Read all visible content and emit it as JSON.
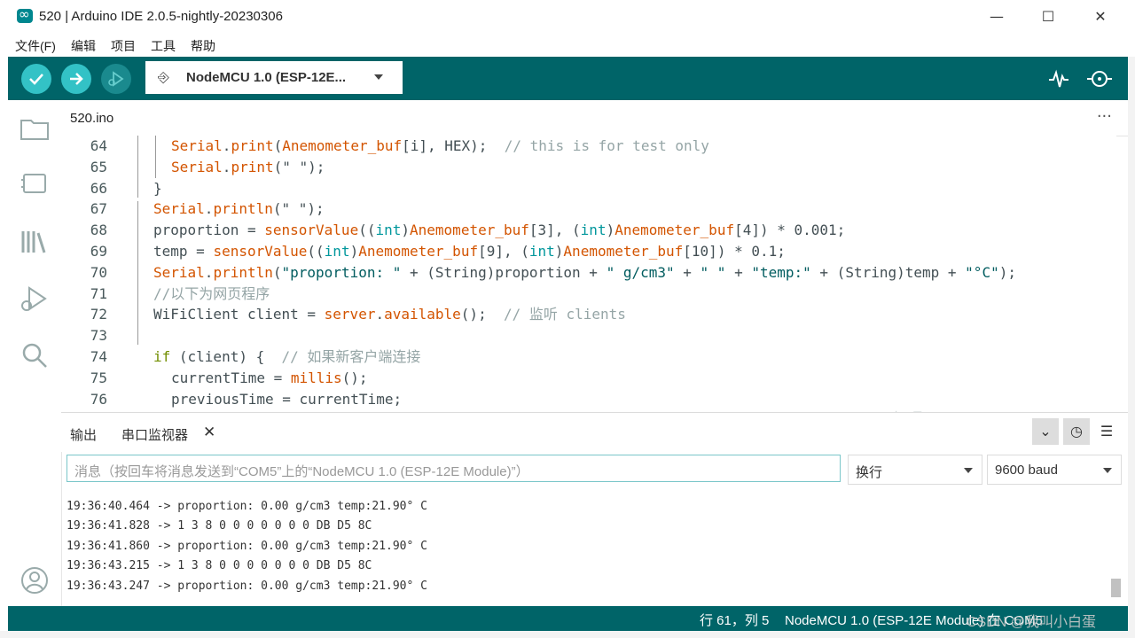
{
  "window": {
    "title": "520 | Arduino IDE 2.0.5-nightly-20230306",
    "minimize": "—",
    "maximize": "☐",
    "close": "✕"
  },
  "menu": [
    "文件(F)",
    "编辑",
    "项目",
    "工具",
    "帮助"
  ],
  "toolbar": {
    "verify_icon": "check-icon",
    "upload_icon": "arrow-right-icon",
    "debug_icon": "debug-icon",
    "board_name": "NodeMCU 1.0 (ESP-12E...",
    "usb_icon": "⎆",
    "plotter_icon": "⌇",
    "monitor_icon": "⊙"
  },
  "sidebar": [
    "folder-icon",
    "board-icon",
    "library-icon",
    "debug-icon",
    "search-icon",
    "account-icon"
  ],
  "tab": {
    "filename": "520.ino",
    "more": "···"
  },
  "code": [
    {
      "ln": "64",
      "indent": 6,
      "parts": [
        [
          "fn",
          "Serial"
        ],
        [
          "",
          "."
        ],
        [
          "fn",
          "print"
        ],
        [
          "",
          "("
        ],
        [
          "fn",
          "Anemometer_buf"
        ],
        [
          "",
          "[i], HEX);  "
        ],
        [
          "cmt",
          "// this is for test only"
        ]
      ]
    },
    {
      "ln": "65",
      "indent": 6,
      "parts": [
        [
          "fn",
          "Serial"
        ],
        [
          "",
          "."
        ],
        [
          "fn",
          "print"
        ],
        [
          "",
          "(\" \");"
        ]
      ]
    },
    {
      "ln": "66",
      "indent": 4,
      "parts": [
        [
          "",
          "}"
        ]
      ]
    },
    {
      "ln": "67",
      "indent": 4,
      "parts": [
        [
          "fn",
          "Serial"
        ],
        [
          "",
          "."
        ],
        [
          "fn",
          "println"
        ],
        [
          "",
          "(\" \");"
        ]
      ]
    },
    {
      "ln": "68",
      "indent": 4,
      "parts": [
        [
          "",
          "proportion = "
        ],
        [
          "fn",
          "sensorValue"
        ],
        [
          "",
          "(("
        ],
        [
          "type",
          "int"
        ],
        [
          "",
          ")"
        ],
        [
          "fn",
          "Anemometer_buf"
        ],
        [
          "",
          "[3], ("
        ],
        [
          "type",
          "int"
        ],
        [
          "",
          ")"
        ],
        [
          "fn",
          "Anemometer_buf"
        ],
        [
          "",
          "[4]) * 0.001;"
        ]
      ]
    },
    {
      "ln": "69",
      "indent": 4,
      "parts": [
        [
          "",
          "temp = "
        ],
        [
          "fn",
          "sensorValue"
        ],
        [
          "",
          "(("
        ],
        [
          "type",
          "int"
        ],
        [
          "",
          ")"
        ],
        [
          "fn",
          "Anemometer_buf"
        ],
        [
          "",
          "[9], ("
        ],
        [
          "type",
          "int"
        ],
        [
          "",
          ")"
        ],
        [
          "fn",
          "Anemometer_buf"
        ],
        [
          "",
          "[10]) * 0.1;"
        ]
      ]
    },
    {
      "ln": "70",
      "indent": 4,
      "parts": [
        [
          "fn",
          "Serial"
        ],
        [
          "",
          "."
        ],
        [
          "fn",
          "println"
        ],
        [
          "",
          "("
        ],
        [
          "str",
          "\"proportion: \""
        ],
        [
          "",
          " + (String)proportion + "
        ],
        [
          "str",
          "\" g/cm3\""
        ],
        [
          "",
          " + "
        ],
        [
          "str",
          "\" \""
        ],
        [
          "",
          " + "
        ],
        [
          "str",
          "\"temp:\""
        ],
        [
          "",
          " + (String)temp + "
        ],
        [
          "str",
          "\"°C\""
        ],
        [
          "",
          ");"
        ]
      ]
    },
    {
      "ln": "71",
      "indent": 4,
      "parts": [
        [
          "cmt",
          "//以下为网页程序"
        ]
      ]
    },
    {
      "ln": "72",
      "indent": 4,
      "parts": [
        [
          "",
          "WiFiClient client = "
        ],
        [
          "fn",
          "server"
        ],
        [
          "",
          "."
        ],
        [
          "fn",
          "available"
        ],
        [
          "",
          "();  "
        ],
        [
          "cmt",
          "// 监听 clients"
        ]
      ]
    },
    {
      "ln": "73",
      "indent": 0,
      "parts": []
    },
    {
      "ln": "74",
      "indent": 4,
      "parts": [
        [
          "ctrl",
          "if"
        ],
        [
          "",
          " (client) {  "
        ],
        [
          "cmt",
          "// 如果新客户端连接"
        ]
      ]
    },
    {
      "ln": "75",
      "indent": 6,
      "parts": [
        [
          "",
          "currentTime = "
        ],
        [
          "fn",
          "millis"
        ],
        [
          "",
          "();"
        ]
      ]
    },
    {
      "ln": "76",
      "indent": 6,
      "parts": [
        [
          "",
          "previousTime = currentTime;"
        ]
      ]
    }
  ],
  "panel": {
    "tab_output": "输出",
    "tab_serial": "串口监视器",
    "close": "✕",
    "btn_autoscroll": "⌄",
    "btn_timestamp": "◷",
    "btn_clear": "☰"
  },
  "serial": {
    "placeholder": "消息（按回车将消息发送到“COM5”上的“NodeMCU 1.0 (ESP-12E Module)”）",
    "line_ending": "换行",
    "baud": "9600 baud",
    "lines": [
      "19:36:40.464 -> proportion: 0.00 g/cm3 temp:21.90° C",
      "19:36:41.828 -> 1 3 8 0 0 0 0 0 0 0 DB D5 8C",
      "19:36:41.860 -> proportion: 0.00 g/cm3 temp:21.90° C",
      "19:36:43.215 -> 1 3 8 0 0 0 0 0 0 0 DB D5 8C",
      "19:36:43.247 -> proportion: 0.00 g/cm3 temp:21.90° C"
    ]
  },
  "status": {
    "position": "行 61，列 5",
    "board": "NodeMCU 1.0 (ESP-12E Module) 在 COM5"
  },
  "watermark": "CSDN @我叫小白蛋",
  "faint_text": "一 一 一 如 果 一 一 一"
}
